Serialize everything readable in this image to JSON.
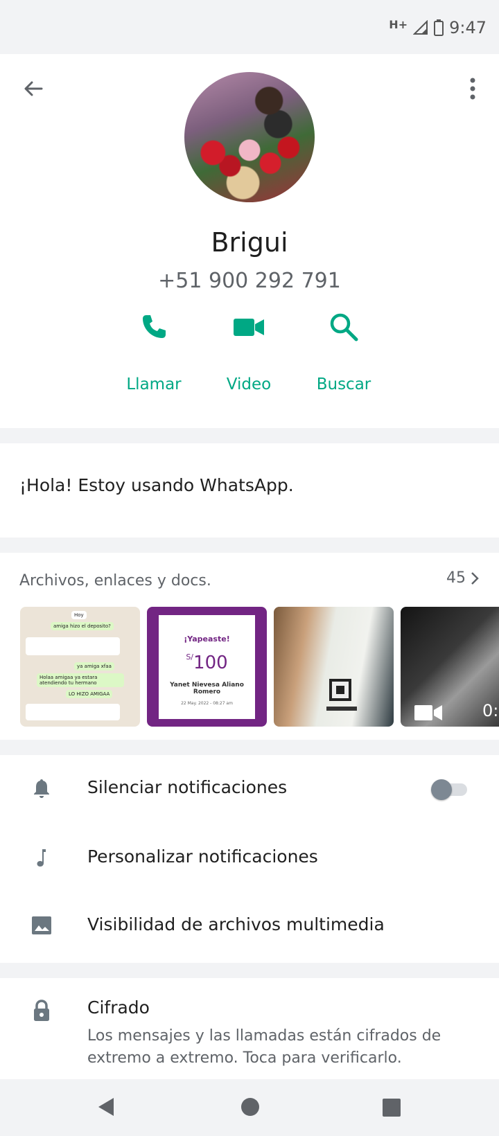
{
  "status": {
    "network": "H+",
    "time": "9:47"
  },
  "contact": {
    "name": "Brigui",
    "phone": "+51 900 292 791"
  },
  "actions": [
    {
      "label": "Llamar",
      "icon": "phone-icon"
    },
    {
      "label": "Video",
      "icon": "videocam-icon"
    },
    {
      "label": "Buscar",
      "icon": "search-icon"
    }
  ],
  "about": {
    "text": "¡Hola! Estoy usando WhatsApp."
  },
  "media": {
    "title": "Archivos, enlaces y docs.",
    "count": "45",
    "thumbs": {
      "chat_day": "Hoy",
      "chat_lines": [
        "amiga hizo el deposito?",
        "ya amiga xfaa",
        "Holaa amigaa ya estara atendiendo tu hermano",
        "LO HIZO AMIGAA"
      ],
      "yape_title": "¡Yapeaste!",
      "yape_currency": "S/",
      "yape_amount": "100",
      "yape_name": "Yanet Nievesa Aliano Romero",
      "yape_date": "22 May. 2022 - 08:27 am",
      "video_time": "0:"
    }
  },
  "settings": [
    {
      "label": "Silenciar notificaciones",
      "icon": "bell-icon",
      "toggle": false
    },
    {
      "label": "Personalizar notificaciones",
      "icon": "music-note-icon"
    },
    {
      "label": "Visibilidad de archivos multimedia",
      "icon": "image-icon"
    }
  ],
  "encryption": {
    "title": "Cifrado",
    "description": "Los mensajes y las llamadas están cifrados de extremo a extremo. Toca para verificarlo."
  },
  "colors": {
    "accent": "#00a884",
    "icon_gray": "#6b7780",
    "background": "#f2f3f5"
  }
}
